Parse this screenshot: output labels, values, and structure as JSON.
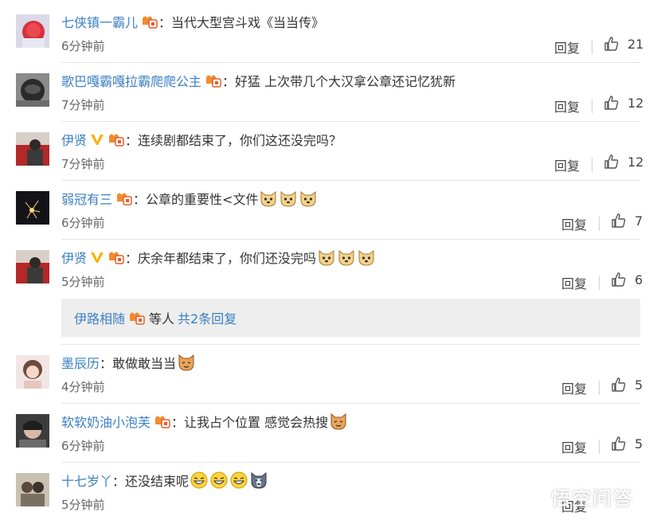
{
  "comments": [
    {
      "name": "七侠镇一霸儿",
      "text": "当代大型宫斗戏《当当传》",
      "time": "6分钟前",
      "reply": "回复",
      "likes": "21"
    },
    {
      "name": "歌巴嘎霸嘎拉霸爬爬公主",
      "text": "好猛 上次带几个大汉拿公章还记忆犹新",
      "time": "7分钟前",
      "reply": "回复",
      "likes": "12"
    },
    {
      "name": "伊贤",
      "text": "连续剧都结束了，你们这还没完吗？",
      "time": "7分钟前",
      "reply": "回复",
      "likes": "12"
    },
    {
      "name": "弱冠有三",
      "text": "公章的重要性<文件",
      "time": "6分钟前",
      "reply": "回复",
      "likes": "7"
    },
    {
      "name": "伊贤",
      "text": "庆余年都结束了，你们还没完吗",
      "time": "5分钟前",
      "reply": "回复",
      "likes": "6"
    },
    {
      "name": "墨辰历",
      "text": "敢做敢当当",
      "time": "4分钟前",
      "reply": "回复",
      "likes": "5"
    },
    {
      "name": "软软奶油小泡芙",
      "text": "让我占个位置 感觉会热搜",
      "time": "6分钟前",
      "reply": "回复",
      "likes": "5"
    },
    {
      "name": "十七岁丫",
      "text": "还没结束呢",
      "time": "5分钟前",
      "reply": "回复"
    }
  ],
  "reply_summary": {
    "name": "伊路相随",
    "others": "等人",
    "count": "共2条回复"
  },
  "colon": "：",
  "watermark": "悟空问答",
  "colors": {
    "link": "#3a7fc4",
    "badge": "#f28a2e",
    "vip": "#f6b300"
  },
  "icons": [
    "thumbs-up-icon",
    "member-badge-icon",
    "verified-v-icon",
    "doge-emoji",
    "cat-emoji",
    "grin-emoji",
    "husky-emoji",
    "wukong-logo"
  ]
}
